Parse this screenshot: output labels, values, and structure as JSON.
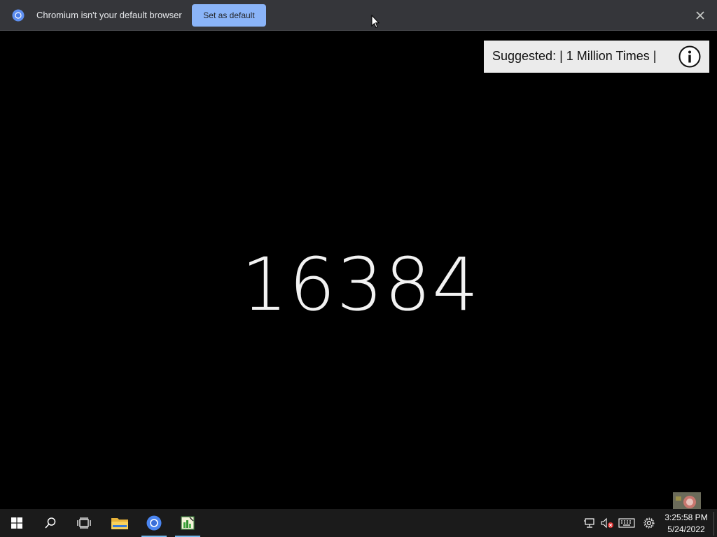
{
  "infobar": {
    "message": "Chromium isn't your default browser",
    "button_label": "Set as default",
    "close_icon": "close-icon",
    "logo_icon": "chromium-logo-icon"
  },
  "suggestion": {
    "text": "Suggested: | 1 Million Times |",
    "icon": "info-icon"
  },
  "counter": {
    "value": "16384"
  },
  "taskbar": {
    "start_icon": "windows-start-icon",
    "search_icon": "search-icon",
    "taskview_icon": "task-view-icon",
    "apps": [
      {
        "name": "file-explorer-icon",
        "active": false
      },
      {
        "name": "chromium-icon",
        "active": true
      },
      {
        "name": "notepad-app-icon",
        "active": true
      }
    ],
    "tray": {
      "network_icon": "network-icon",
      "volume_icon": "volume-muted-icon",
      "keyboard_icon": "keyboard-icon",
      "settings_icon": "gear-icon"
    },
    "clock": {
      "time": "3:25:58 PM",
      "date": "5/24/2022"
    }
  },
  "colors": {
    "infobar_bg": "#35363a",
    "button_bg": "#8ab4f8",
    "taskbar_bg": "#1b1b1b",
    "active_indicator": "#76b9ed"
  }
}
